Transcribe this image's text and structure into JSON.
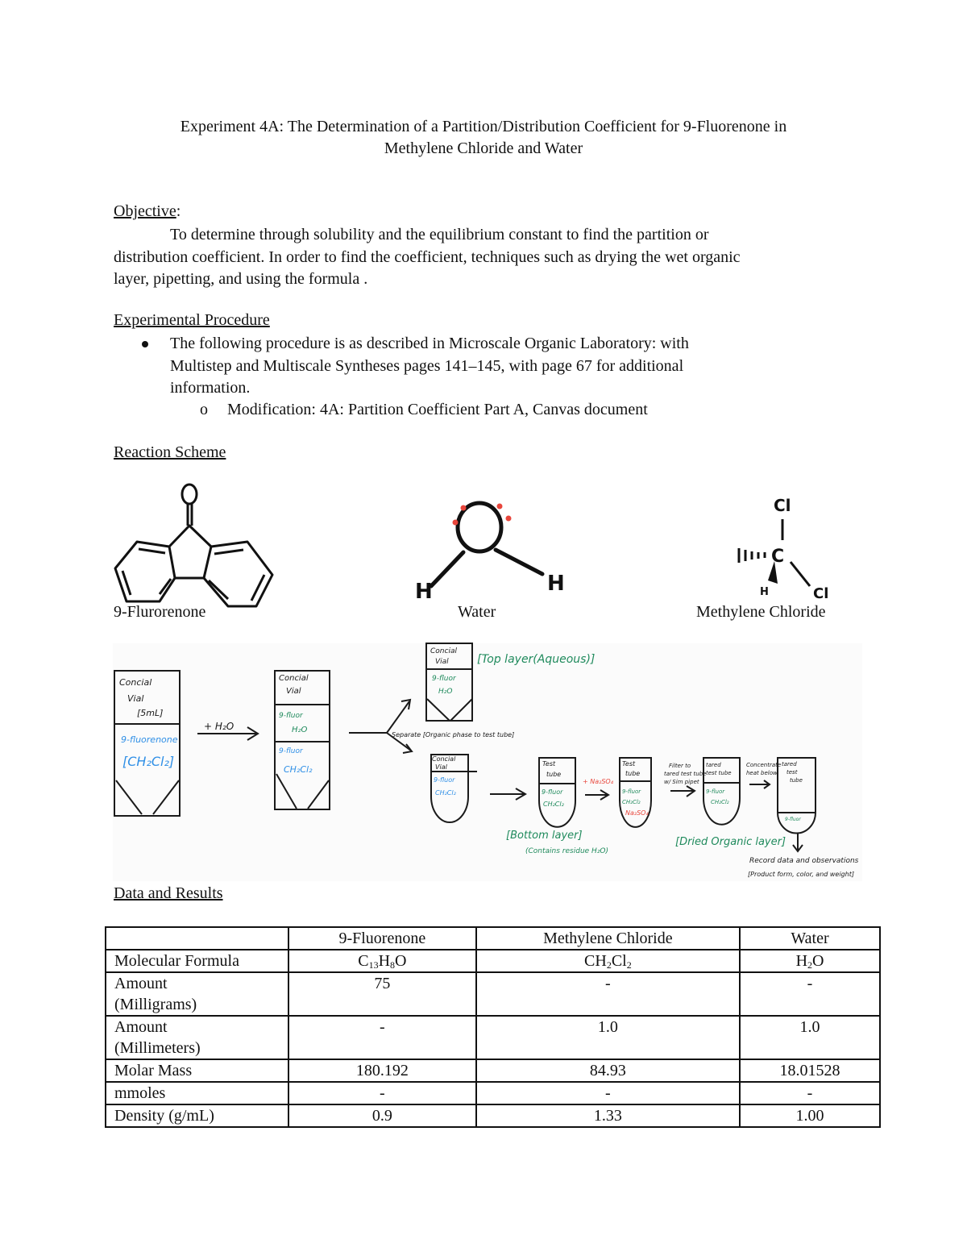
{
  "document": {
    "title_line1": "Experiment 4A: The Determination of a Partition/Distribution Coefficient for 9-Fluorenone in",
    "title_line2": "Methylene Chloride and Water",
    "objective": {
      "heading": "Objective",
      "heading_suffix": ":",
      "line1": "To determine through solubility and the equilibrium constant to find the partition or",
      "line2": "distribution coefficient. In order to find the coefficient, techniques such as drying the wet organic",
      "line3": "layer, pipetting, and using the formula ."
    },
    "procedure": {
      "heading": "Experimental Procedure",
      "bullet_line1": "The following procedure is as described in Microscale Organic Laboratory: with",
      "bullet_line2": "Multistep and Multiscale Syntheses pages 141–145, with page 67 for additional",
      "bullet_line3": "information.",
      "sub_marker": "o",
      "sub_item": "Modification: 4A: Partition Coefficient Part A, Canvas document"
    },
    "reaction_scheme": {
      "heading": "Reaction Scheme",
      "molecules": [
        {
          "label": "9-Flurorenone"
        },
        {
          "label": "Water",
          "atoms": {
            "o": "O",
            "h": "H"
          }
        },
        {
          "label": "Methylene Chloride",
          "atoms": {
            "cl": "Cl",
            "c": "C",
            "h": "H"
          }
        }
      ]
    },
    "flow_diagram": {
      "ink_colors": {
        "black": "#1a1a1a",
        "blue": "#2f8fe6",
        "green": "#1f8a5c",
        "red": "#e8463c"
      },
      "vial1": {
        "top1": "Concial",
        "top2": "Vial",
        "top3": "[5mL]",
        "bottom1": "9-fluorenone",
        "bottom2": "[CH₂Cl₂]"
      },
      "add_water": "+ H₂O",
      "vial2": {
        "top1": "Concial",
        "top2": "Vial",
        "mid1": "9-fluor",
        "mid2": "H₂O",
        "bottom1": "9-fluor",
        "bottom2": "CH₂Cl₂"
      },
      "separate_note": "Separate [Organic phase to test tube]",
      "vial_top": {
        "top1": "Concial",
        "top2": "Vial",
        "mid1": "9-fluor",
        "mid2": "H₂O"
      },
      "top_layer_note": "[Top layer(Aqueous)]",
      "vial_bottom": {
        "top1": "Concial",
        "top2": "Vial",
        "bottom1": "9-fluor",
        "bottom2": "CH₂Cl₂"
      },
      "tube1": {
        "top1": "Test",
        "top2": "tube",
        "bottom1": "9-fluor",
        "bottom2": "CH₂Cl₂"
      },
      "bottom_layer_note": "[Bottom layer]",
      "bottom_layer_sub": "(Contains residue H₂O)",
      "add_na2so4": "+ Na₂SO₄",
      "tube2": {
        "top1": "Test",
        "top2": "tube",
        "bottom1": "9-fluor",
        "bottom2": "CH₂Cl₂",
        "bottom3": "Na₂SO₄"
      },
      "filter_note1": "Filter to",
      "filter_note2": "tared test tube",
      "filter_note3": "w/ Sim pipet",
      "tube3": {
        "top1": "tared",
        "top2": "test tube",
        "bottom1": "9-fluor",
        "bottom2": "CH₂Cl₂"
      },
      "dried_note": "[Dried Organic layer]",
      "concentrate_note1": "Concentrate",
      "concentrate_note2": "heat below",
      "tube4": {
        "top1": "tared",
        "top2": "test",
        "top3": "tube",
        "bottom1": "9-fluor"
      },
      "record_note": "Record data and observations",
      "record_sub": "[Product form, color, and weight]"
    },
    "data_results": {
      "heading": "Data and Results",
      "columns": [
        "",
        "9-Fluorenone",
        "Methylene Chloride",
        "Water"
      ],
      "rows": [
        {
          "label": "Molecular Formula",
          "values": [
            "C13H8O",
            "CH2Cl2",
            "H2O"
          ]
        },
        {
          "label_line1": "Amount",
          "label_line2": "(Milligrams)",
          "values": [
            "75",
            "-",
            "-"
          ]
        },
        {
          "label_line1": "Amount",
          "label_line2": "(Millimeters)",
          "values": [
            "-",
            "1.0",
            "1.0"
          ]
        },
        {
          "label": "Molar Mass",
          "values": [
            "180.192",
            "84.93",
            "18.01528"
          ]
        },
        {
          "label": "mmoles",
          "values": [
            "-",
            "-",
            "-"
          ]
        },
        {
          "label": "Density (g/mL)",
          "values": [
            "0.9",
            "1.33",
            "1.00"
          ]
        }
      ]
    }
  }
}
